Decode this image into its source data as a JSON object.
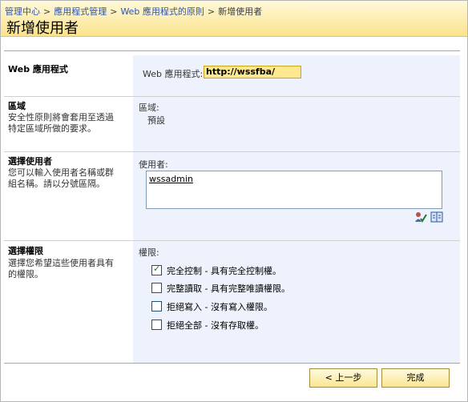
{
  "breadcrumb": {
    "items": [
      "管理中心",
      "應用程式管理",
      "Web 應用程式的原則"
    ],
    "current": "新增使用者",
    "separator": ">"
  },
  "page": {
    "title": "新增使用者"
  },
  "sections": {
    "web_app": {
      "title": "Web 應用程式",
      "field_label": "Web 應用程式:",
      "value": "http://wssfba/"
    },
    "zone": {
      "title": "區域",
      "description": "安全性原則將會套用至透過特定區域所做的要求。",
      "field_label": "區域:",
      "value": "預設"
    },
    "users": {
      "title": "選擇使用者",
      "description": "您可以輸入使用者名稱或群組名稱。請以分號區隔。",
      "field_label": "使用者:",
      "value": "wssadmin"
    },
    "permissions": {
      "title": "選擇權限",
      "description": "選擇您希望這些使用者具有的權限。",
      "field_label": "權限:",
      "options": [
        {
          "label": "完全控制 - 具有完全控制權。",
          "checked": true
        },
        {
          "label": "完整讀取 - 具有完整唯讀權限。",
          "checked": false
        },
        {
          "label": "拒絕寫入 - 沒有寫入權限。",
          "checked": false
        },
        {
          "label": "拒絕全部 - 沒有存取權。",
          "checked": false
        }
      ]
    }
  },
  "buttons": {
    "back": "< 上一步",
    "finish": "完成"
  },
  "icons": {
    "check_names": "check-names-icon",
    "browse": "address-book-icon"
  },
  "colors": {
    "header_top": "#fff9d9",
    "header_bottom": "#fbe38c",
    "link": "#2d54a7",
    "pane": "#eef2fc",
    "url_highlight": "#ffe88f"
  }
}
